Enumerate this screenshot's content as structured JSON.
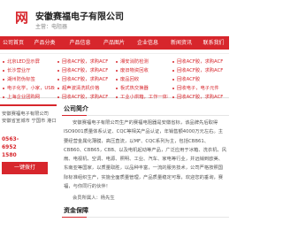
{
  "header": {
    "logo_text": "网",
    "title": "安徽赛福电子有限公司",
    "subtitle": "主营：电阻器"
  },
  "colors": {
    "brand": "#d7262c"
  },
  "nav": {
    "items": [
      "公司首页",
      "产品分类",
      "产品信息",
      "产品图片",
      "企业信息",
      "新闻资讯",
      "联系我们"
    ]
  },
  "links": {
    "col1": [
      "北京LED显示屏",
      "长沙营业厅",
      "湖州防伪标签",
      "电子化学，小家，USB线",
      "上海企业团购网"
    ],
    "col2": [
      "回收ACF胶，求购ACF",
      "回收ACF胶，求购ACF",
      "回收ACF胶，求购ACF",
      "超声波清洗机价格",
      "回收ACF胶，求购ACF"
    ],
    "col3": [
      "湘安消防检测",
      "废旧物资回收",
      "废品回收",
      "板式热交换器",
      "工业小烘箱，工作一体机"
    ],
    "col4": [
      "回收ACF胶，求购ACF",
      "回收ACF胶，求购ACF",
      "回收ACF胶",
      "回收电子，电子元件",
      "回收ACF胶，求购ACF"
    ]
  },
  "left_panel": {
    "company": "安徽赛福电子有限公司",
    "address": "安徽省宣城市 宁国市 港口镇山泉开发区",
    "phone1": "0563-",
    "phone1_suffix": "6952",
    "phone2": "1580",
    "button": "一键拨打"
  },
  "about": {
    "title": "公司简介",
    "body": "安徽赛福电子有限公司生产的赛福电阻器是安徽省标，该品牌先后取得ISO9001质量体系认证、CQC等相关产品认证，年销售额4000万元左右。主要经营金属化薄膜，高压直流，以MF、CQC系列为主，包括CBB61、CBB60、CBB65，CBB、以及电机起动等产品，广泛应用于冰箱、洗衣机、风扇、电视机、空调、电源、照明、工业、汽车、家电等行业，并远销到欧美、东南亚等国家，以质量取胜，以品种丰富，一流的服务技术，公司严格按照国际标准组织生产，实施全面质量管理，产品质量稳定可靠，欢迎您的垂询，赛福，与你同行的伙伴！",
    "more": "会员所属人：杨先生",
    "section2": "资金保障"
  }
}
